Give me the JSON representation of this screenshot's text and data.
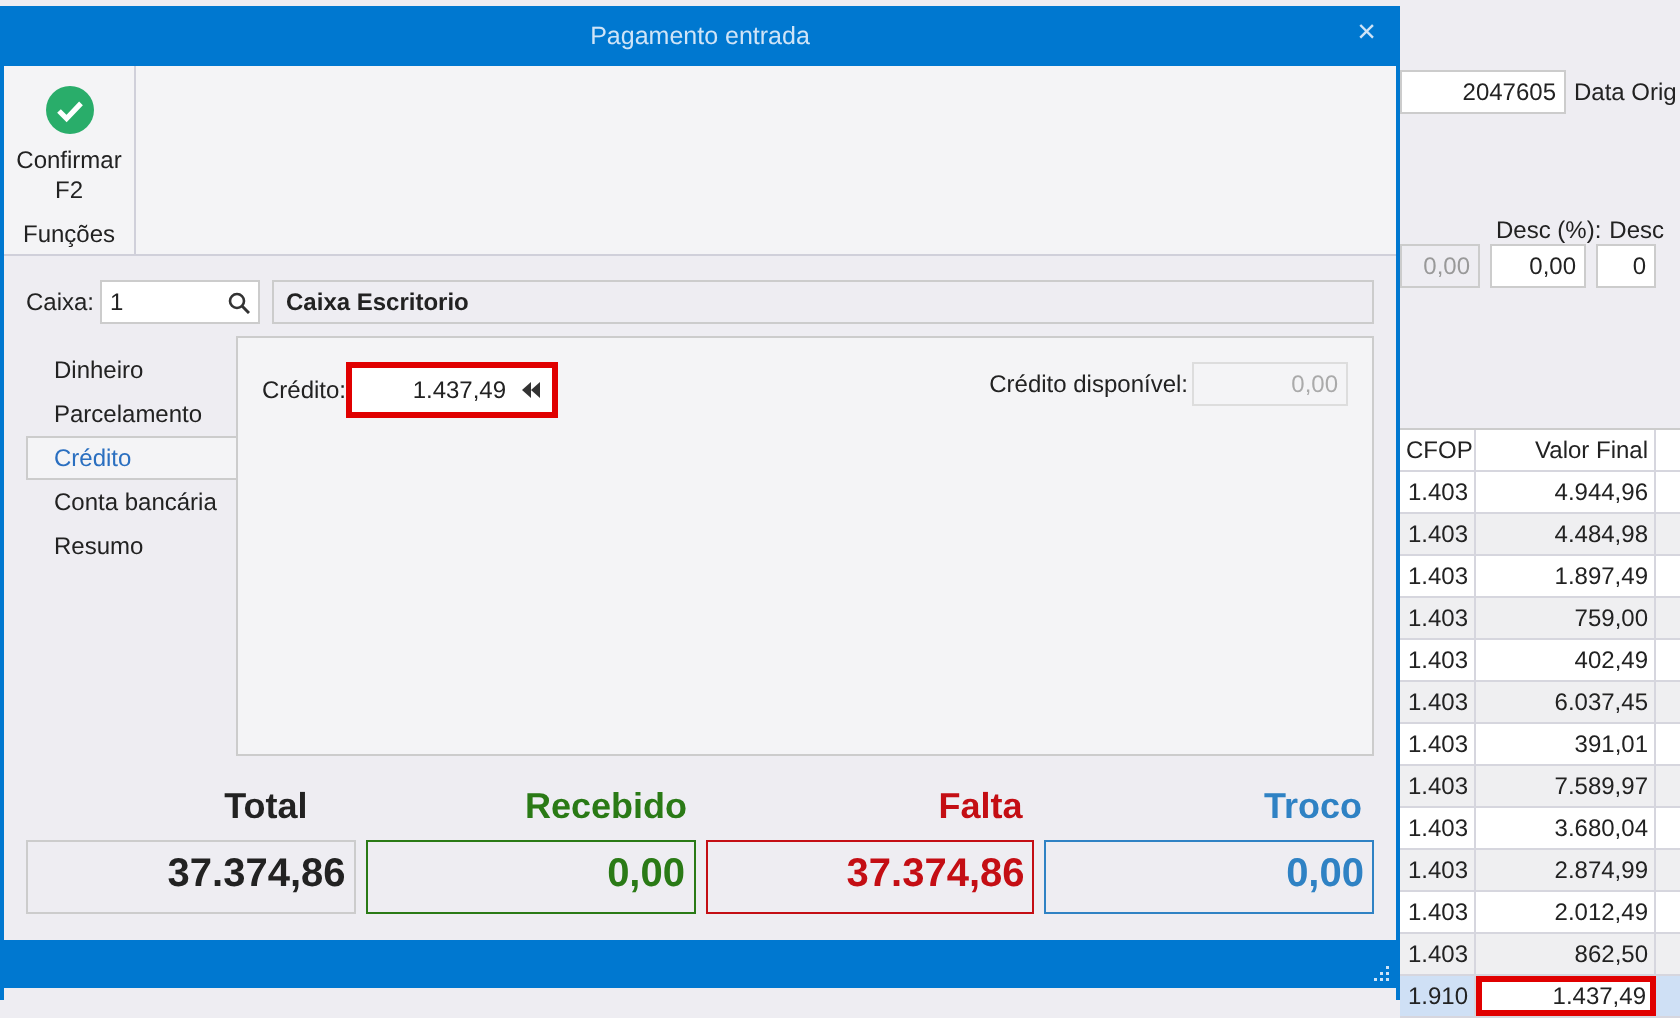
{
  "background": {
    "document_number": "2047605",
    "date_label": "Data Orig",
    "discount_labels": [
      "Desc (%):",
      "Desc"
    ],
    "discount_fields": [
      {
        "value": "0,00",
        "disabled": true
      },
      {
        "value": "0,00",
        "disabled": false
      },
      {
        "value": "0",
        "disabled": false
      }
    ],
    "table": {
      "columns": [
        "CFOP",
        "Valor Final"
      ],
      "rows": [
        {
          "cells": [
            "1.403",
            "4.944,96"
          ],
          "selected": false
        },
        {
          "cells": [
            "1.403",
            "4.484,98"
          ],
          "selected": false
        },
        {
          "cells": [
            "1.403",
            "1.897,49"
          ],
          "selected": false
        },
        {
          "cells": [
            "1.403",
            "759,00"
          ],
          "selected": false
        },
        {
          "cells": [
            "1.403",
            "402,49"
          ],
          "selected": false
        },
        {
          "cells": [
            "1.403",
            "6.037,45"
          ],
          "selected": false
        },
        {
          "cells": [
            "1.403",
            "391,01"
          ],
          "selected": false
        },
        {
          "cells": [
            "1.403",
            "7.589,97"
          ],
          "selected": false
        },
        {
          "cells": [
            "1.403",
            "3.680,04"
          ],
          "selected": false
        },
        {
          "cells": [
            "1.403",
            "2.874,99"
          ],
          "selected": false
        },
        {
          "cells": [
            "1.403",
            "2.012,49"
          ],
          "selected": false
        },
        {
          "cells": [
            "1.403",
            "862,50"
          ],
          "selected": false
        },
        {
          "cells": [
            "1.910",
            "1.437,49"
          ],
          "selected": true
        }
      ]
    }
  },
  "dialog": {
    "title": "Pagamento entrada",
    "close_glyph": "×",
    "toolbar": {
      "button": {
        "lines": [
          "Confirmar",
          "F2"
        ]
      },
      "group_label": "Funções"
    },
    "caixa": {
      "label": "Caixa:",
      "value": "1",
      "description": "Caixa Escritorio"
    },
    "nav": [
      {
        "label": "Dinheiro",
        "selected": false
      },
      {
        "label": "Parcelamento",
        "selected": false
      },
      {
        "label": "Crédito",
        "selected": true
      },
      {
        "label": "Conta bancária",
        "selected": false
      },
      {
        "label": "Resumo",
        "selected": false
      }
    ],
    "credit": {
      "label": "Crédito:",
      "value": "1.437,49",
      "highlighted": true,
      "available_label": "Crédito disponível:",
      "available_value": "0,00"
    },
    "summary": [
      {
        "label": "Total",
        "value": "37.374,86",
        "color": "#222222"
      },
      {
        "label": "Recebido",
        "value": "0,00",
        "color": "#2a7a16"
      },
      {
        "label": "Falta",
        "value": "37.374,86",
        "color": "#c40e14"
      },
      {
        "label": "Troco",
        "value": "0,00",
        "color": "#2f82c4"
      }
    ]
  }
}
